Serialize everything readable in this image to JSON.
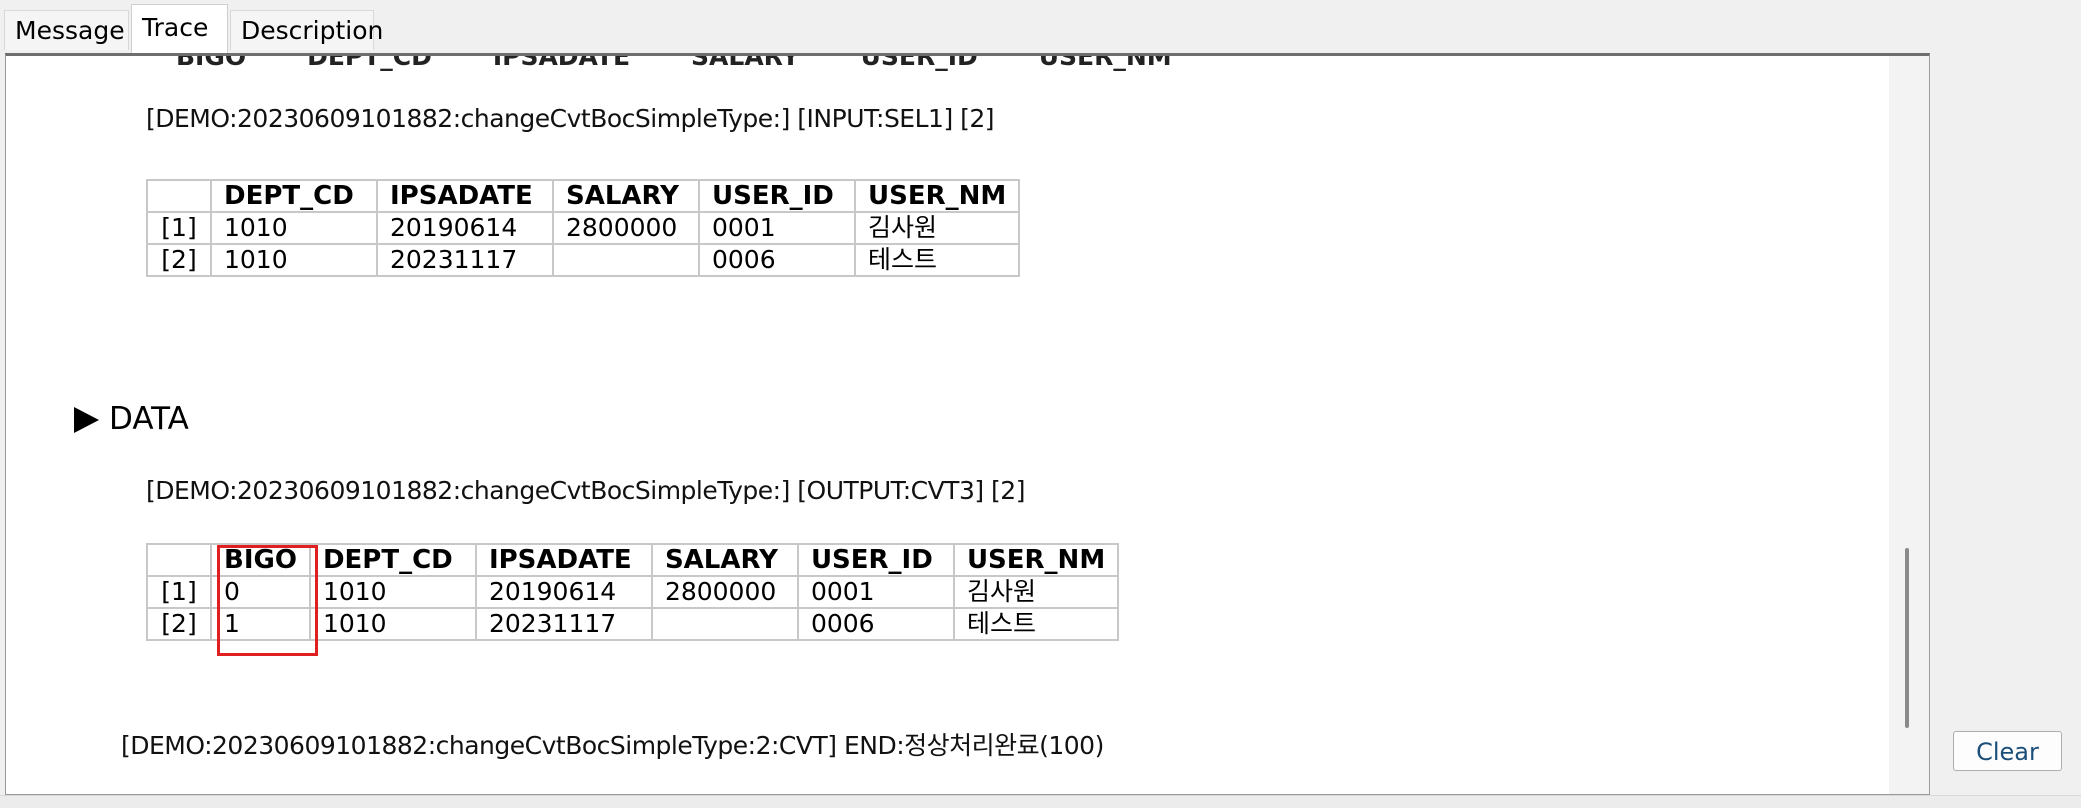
{
  "tabs": [
    {
      "label": "Message"
    },
    {
      "label": "Trace"
    },
    {
      "label": "Description"
    }
  ],
  "top_clipped_header": [
    "BIGO",
    "DEPT_CD",
    "IPSADATE",
    "SALARY",
    "USER_ID",
    "USER_NM"
  ],
  "input_block": {
    "line": "[DEMO:20230609101882:changeCvtBocSimpleType:] [INPUT:SEL1] [2]",
    "columns": [
      "",
      "DEPT_CD",
      "IPSADATE",
      "SALARY",
      "USER_ID",
      "USER_NM"
    ],
    "rows": [
      [
        "[1]",
        "1010",
        "20190614",
        "2800000",
        "0001",
        "김사원"
      ],
      [
        "[2]",
        "1010",
        "20231117",
        "",
        "0006",
        "테스트"
      ]
    ]
  },
  "section": {
    "title": "DATA"
  },
  "output_block": {
    "line": "[DEMO:20230609101882:changeCvtBocSimpleType:] [OUTPUT:CVT3] [2]",
    "columns": [
      "",
      "BIGO",
      "DEPT_CD",
      "IPSADATE",
      "SALARY",
      "USER_ID",
      "USER_NM"
    ],
    "rows": [
      [
        "[1]",
        "0",
        "1010",
        "20190614",
        "2800000",
        "0001",
        "김사원"
      ],
      [
        "[2]",
        "1",
        "1010",
        "20231117",
        "",
        "0006",
        "테스트"
      ]
    ]
  },
  "end_line": "[DEMO:20230609101882:changeCvtBocSimpleType:2:CVT] END:정상처리완료(100)",
  "clear_label": "Clear",
  "colors": {
    "highlight": "#e02020",
    "button_text": "#1a4f7a"
  }
}
